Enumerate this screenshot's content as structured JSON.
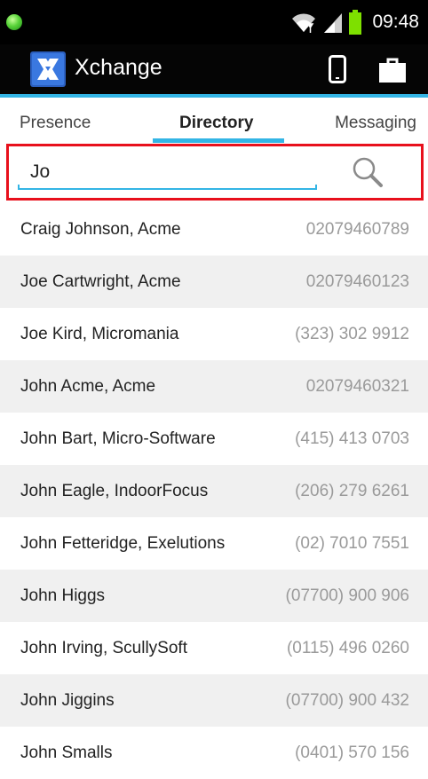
{
  "status_bar": {
    "time": "09:48",
    "icons": [
      "notification-dot-icon",
      "wifi-icon",
      "cell-signal-icon",
      "battery-icon"
    ],
    "battery_color": "#7ee000",
    "notification_color": "#44cc33"
  },
  "action_bar": {
    "title": "Xchange",
    "logo_icon": "xchange-logo-icon",
    "actions": [
      "phone-icon",
      "briefcase-icon"
    ],
    "accent_color": "#33b5e5"
  },
  "tabs": [
    {
      "label": "Presence",
      "selected": false
    },
    {
      "label": "Directory",
      "selected": true
    },
    {
      "label": "Messaging",
      "selected": false
    }
  ],
  "search": {
    "value": "Jo",
    "icon": "search-icon",
    "highlight_color": "#e8101c"
  },
  "directory": {
    "rows": [
      {
        "name": "Craig Johnson, Acme",
        "phone": "02079460789"
      },
      {
        "name": "Joe Cartwright, Acme",
        "phone": "02079460123"
      },
      {
        "name": "Joe Kird, Micromania",
        "phone": "(323) 302 9912"
      },
      {
        "name": "John Acme, Acme",
        "phone": "02079460321"
      },
      {
        "name": "John Bart, Micro-Software",
        "phone": "(415) 413 0703"
      },
      {
        "name": "John Eagle, IndoorFocus",
        "phone": "(206) 279 6261"
      },
      {
        "name": "John Fetteridge, Exelutions",
        "phone": "(02) 7010 7551"
      },
      {
        "name": "John Higgs",
        "phone": "(07700) 900 906"
      },
      {
        "name": "John Irving, ScullySoft",
        "phone": "(0115) 496 0260"
      },
      {
        "name": "John Jiggins",
        "phone": "(07700) 900 432"
      },
      {
        "name": "John Smalls",
        "phone": "(0401) 570 156"
      }
    ]
  }
}
